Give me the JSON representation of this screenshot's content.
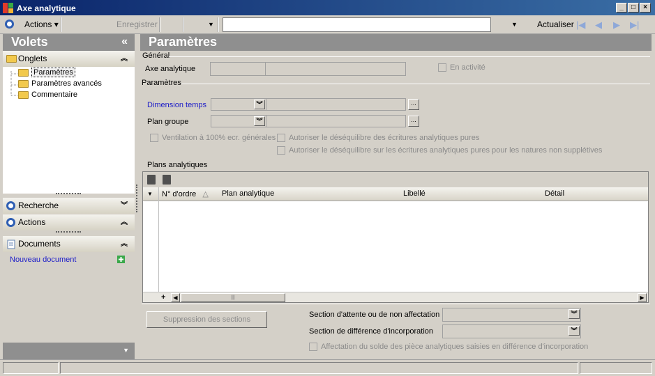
{
  "window": {
    "title": "Axe analytique",
    "minimize": "_",
    "maximize": "□",
    "close": "×"
  },
  "toolbar": {
    "actions_label": "Actions",
    "save_label": "Enregistrer",
    "search_value": "",
    "refresh_label": "Actualiser"
  },
  "left_panel": {
    "title": "Volets",
    "collapse_glyph": "«",
    "onglets": {
      "label": "Onglets",
      "items": [
        "Paramètres",
        "Paramètres avancés",
        "Commentaire"
      ],
      "selected": "Paramètres"
    },
    "recherche_label": "Recherche",
    "actions_label": "Actions",
    "documents": {
      "label": "Documents",
      "new_document": "Nouveau document"
    }
  },
  "main": {
    "title": "Paramètres",
    "general_group": "Général",
    "axe_analytique_label": "Axe analytique",
    "axe_code_value": "",
    "axe_desc_value": "",
    "en_activite_label": "En activité",
    "en_activite_checked": false,
    "parametres_group": "Paramètres",
    "dimension_temps_label": "Dimension temps",
    "dimension_temps_value": "",
    "plan_groupe_label": "Plan groupe",
    "plan_groupe_value": "",
    "ventilation_label": "Ventilation à 100% ecr. générales",
    "autoriser1_label": "Autoriser le déséquilibre des écritures analytiques pures",
    "autoriser2_label": "Autoriser le déséquilibre sur les écritures analytiques pures pour les natures non supplétives",
    "plans_label": "Plans analytiques",
    "grid": {
      "columns": [
        "N° d'ordre",
        "Plan analytique",
        "Libellé",
        "Détail"
      ],
      "sort_glyph": "△",
      "rows": []
    },
    "suppression_button": "Suppression des sections",
    "section_attente_label": "Section d'attente ou de non affectation",
    "section_attente_value": "",
    "section_difference_label": "Section de différence d'incorporation",
    "section_difference_value": "",
    "affectation_label": "Affectation du solde des pièce analytiques saisies en différence d'incorporation"
  },
  "colors": {
    "title_bar": "#0a246a",
    "panel_header": "#8f8f8f",
    "link_blue": "#1c1cc8",
    "accent_icon": "#2f5fb3"
  }
}
